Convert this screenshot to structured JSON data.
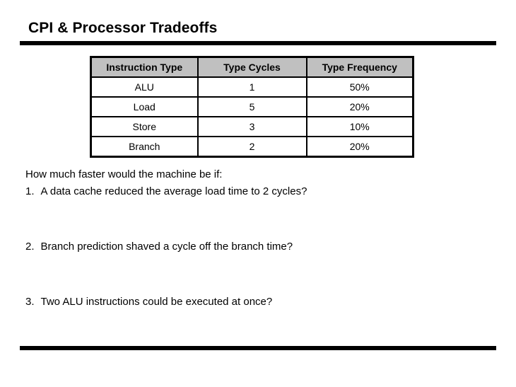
{
  "slide": {
    "title": "CPI & Processor Tradeoffs",
    "accent_color": "#000000",
    "header_fill": "#c0c0c0",
    "background": "#ffffff"
  },
  "table": {
    "columns": [
      "Instruction Type",
      "Type Cycles",
      "Type Frequency"
    ],
    "rows": [
      {
        "type": "ALU",
        "cycles": "1",
        "frequency": "50%"
      },
      {
        "type": "Load",
        "cycles": "5",
        "frequency": "20%"
      },
      {
        "type": "Store",
        "cycles": "3",
        "frequency": "10%"
      },
      {
        "type": "Branch",
        "cycles": "2",
        "frequency": "20%"
      }
    ]
  },
  "chart_data": {
    "type": "table",
    "title": "CPI & Processor Tradeoffs",
    "columns": [
      "Instruction Type",
      "Type Cycles",
      "Type Frequency"
    ],
    "categories": [
      "ALU",
      "Load",
      "Store",
      "Branch"
    ],
    "series": [
      {
        "name": "Type Cycles",
        "values": [
          1,
          5,
          3,
          2
        ]
      },
      {
        "name": "Type Frequency",
        "values": [
          50,
          20,
          10,
          20
        ]
      }
    ],
    "xlabel": "Instruction Type",
    "ylabel": "",
    "grid": true,
    "legend": "none"
  },
  "questions": {
    "lead": "How much faster would the machine be if:",
    "items": [
      {
        "number": "1.",
        "text": "A data cache reduced the average load time to 2 cycles?"
      },
      {
        "number": "2.",
        "text": "Branch prediction shaved a cycle off the branch time?"
      },
      {
        "number": "3.",
        "text": "Two ALU instructions could be executed at once?"
      }
    ]
  }
}
